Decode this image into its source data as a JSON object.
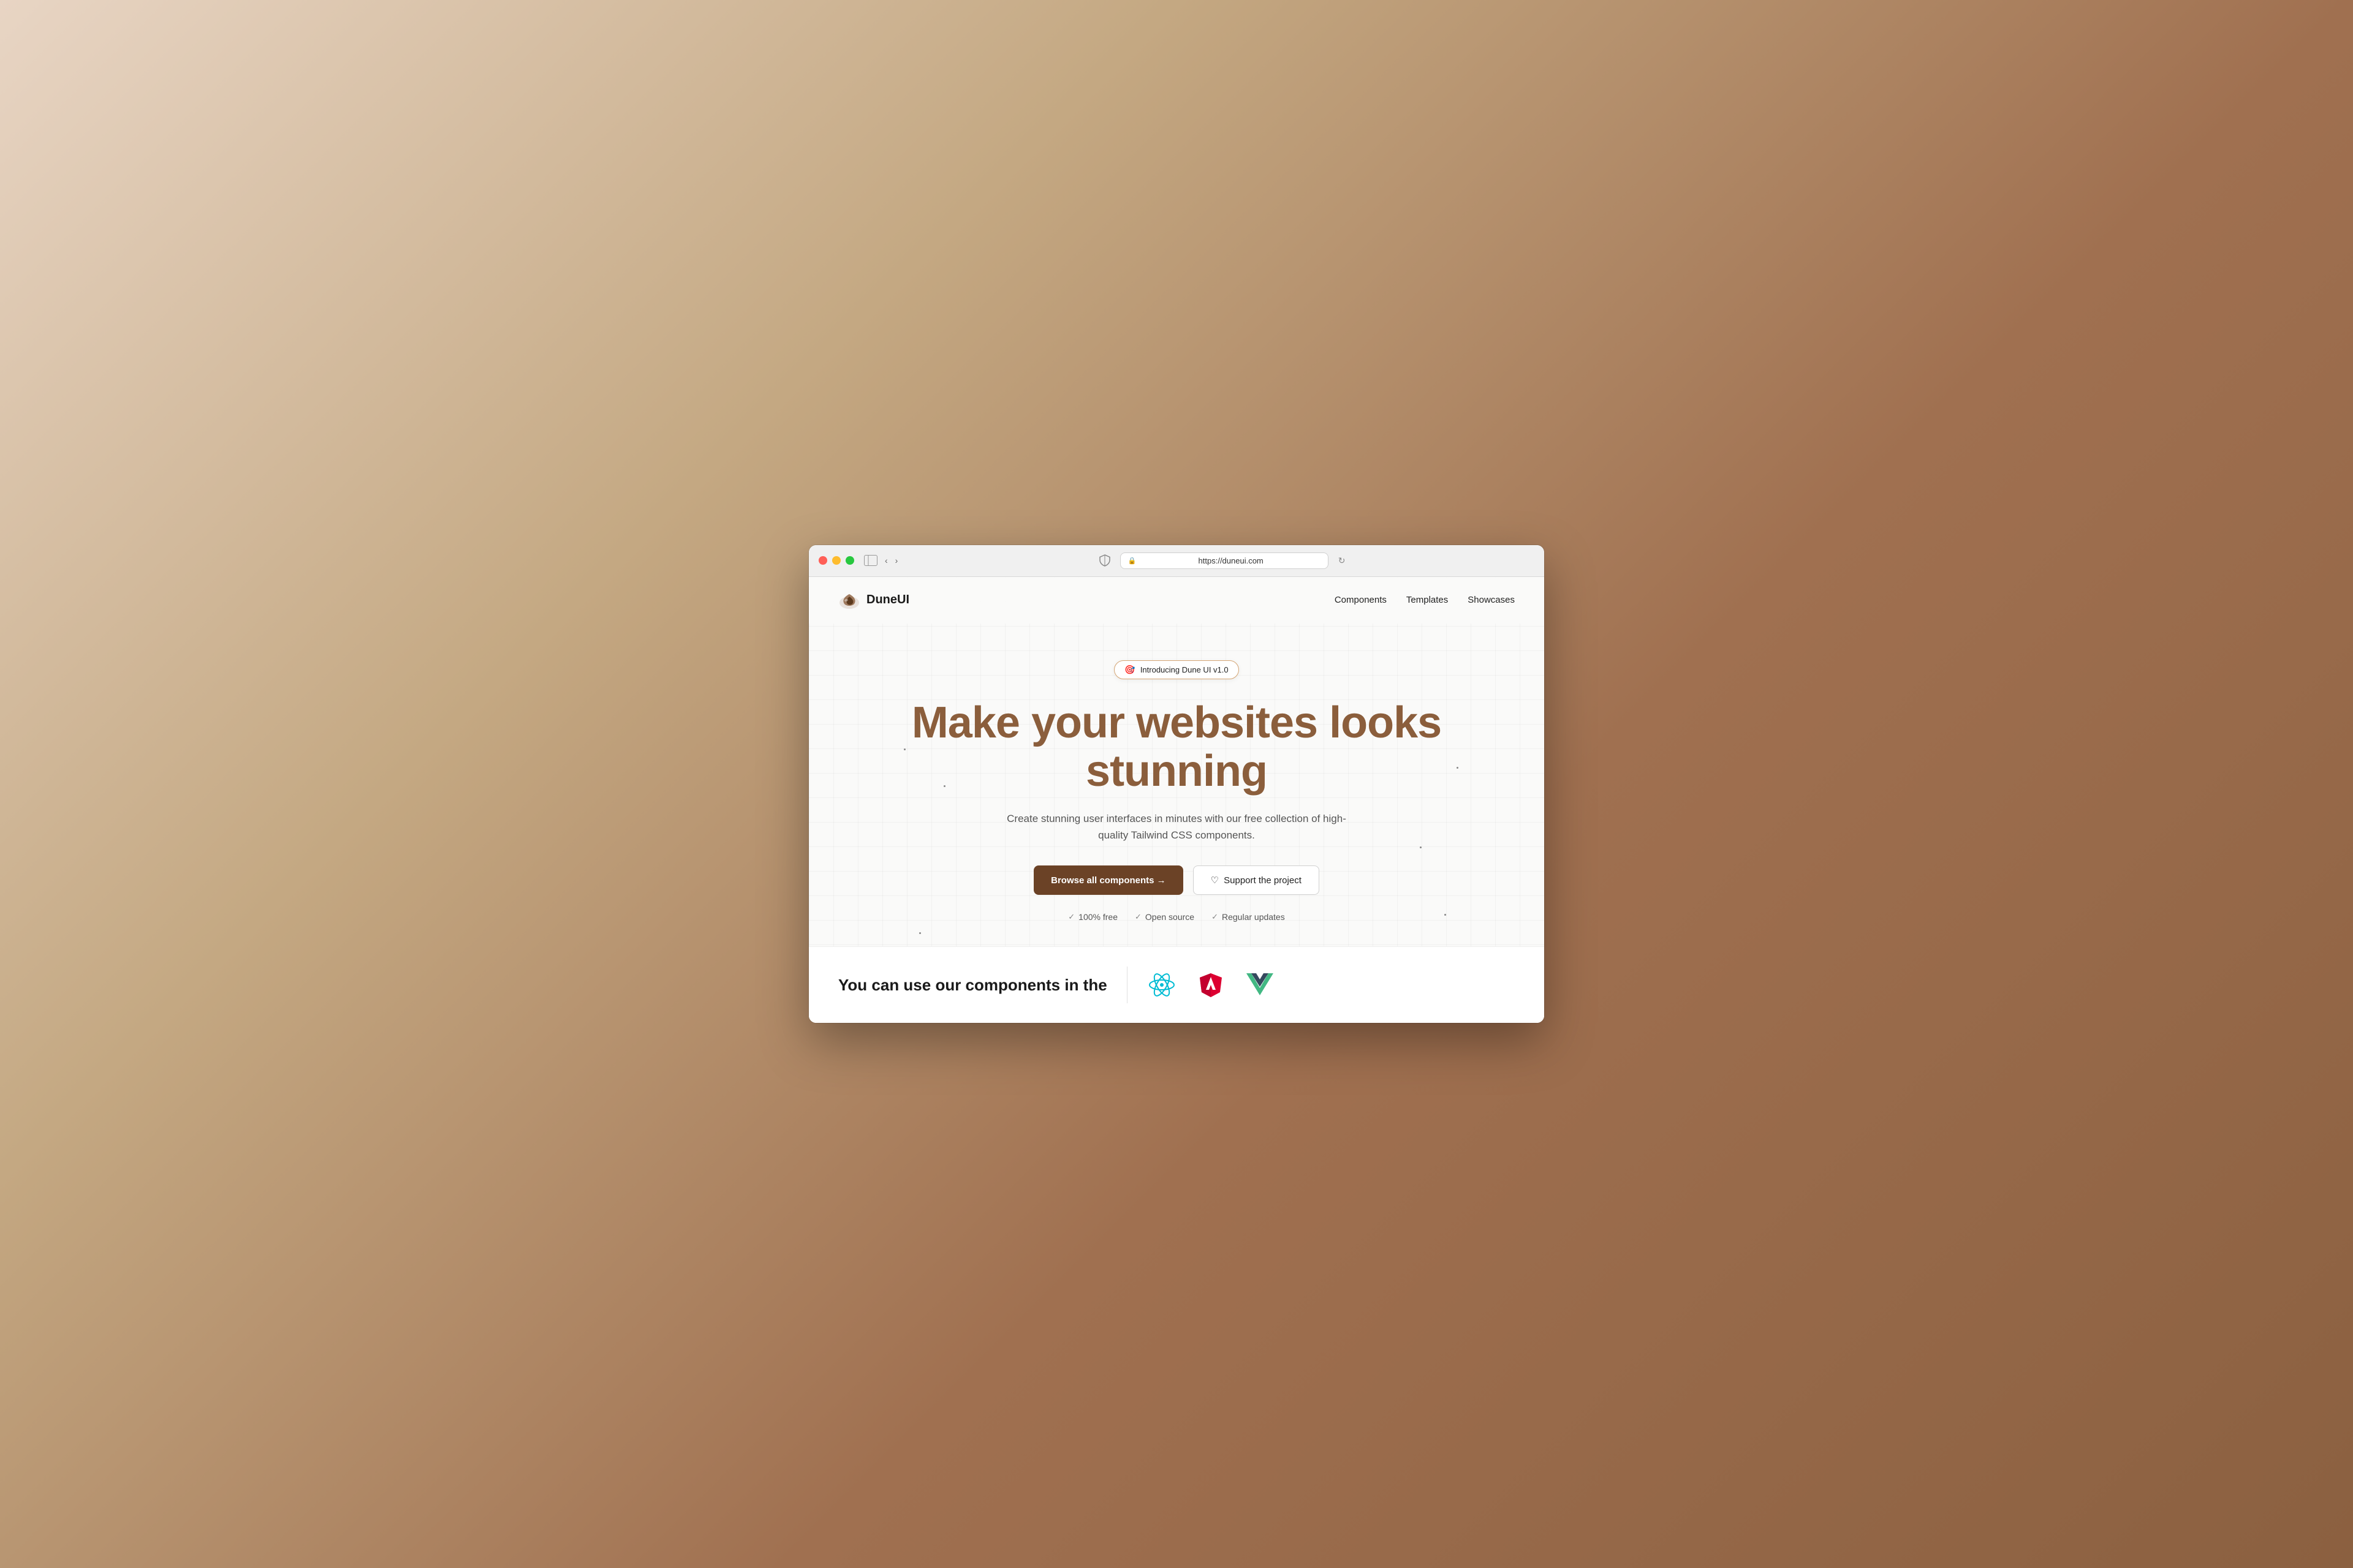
{
  "browser": {
    "url": "https://duneui.com",
    "back_button": "‹",
    "forward_button": "›"
  },
  "nav": {
    "logo_name": "DuneUI",
    "logo_text_normal": "Dune",
    "logo_text_bold": "UI",
    "links": [
      {
        "label": "Components",
        "id": "components"
      },
      {
        "label": "Templates",
        "id": "templates"
      },
      {
        "label": "Showcases",
        "id": "showcases"
      }
    ]
  },
  "hero": {
    "badge_text": "Introducing Dune UI v1.0",
    "title_line1": "Make your websites looks",
    "title_line2": "stunning",
    "subtitle": "Create stunning user interfaces in minutes with our free collection of high-quality Tailwind CSS components.",
    "cta_primary": "Browse all components →",
    "cta_secondary": "Support the project",
    "features": [
      {
        "label": "100% free"
      },
      {
        "label": "Open source"
      },
      {
        "label": "Regular updates"
      }
    ]
  },
  "bottom": {
    "text": "You can use our components in the"
  },
  "colors": {
    "brand_brown": "#8B5E3C",
    "btn_dark": "#6B4226",
    "badge_border": "#d4a574"
  }
}
